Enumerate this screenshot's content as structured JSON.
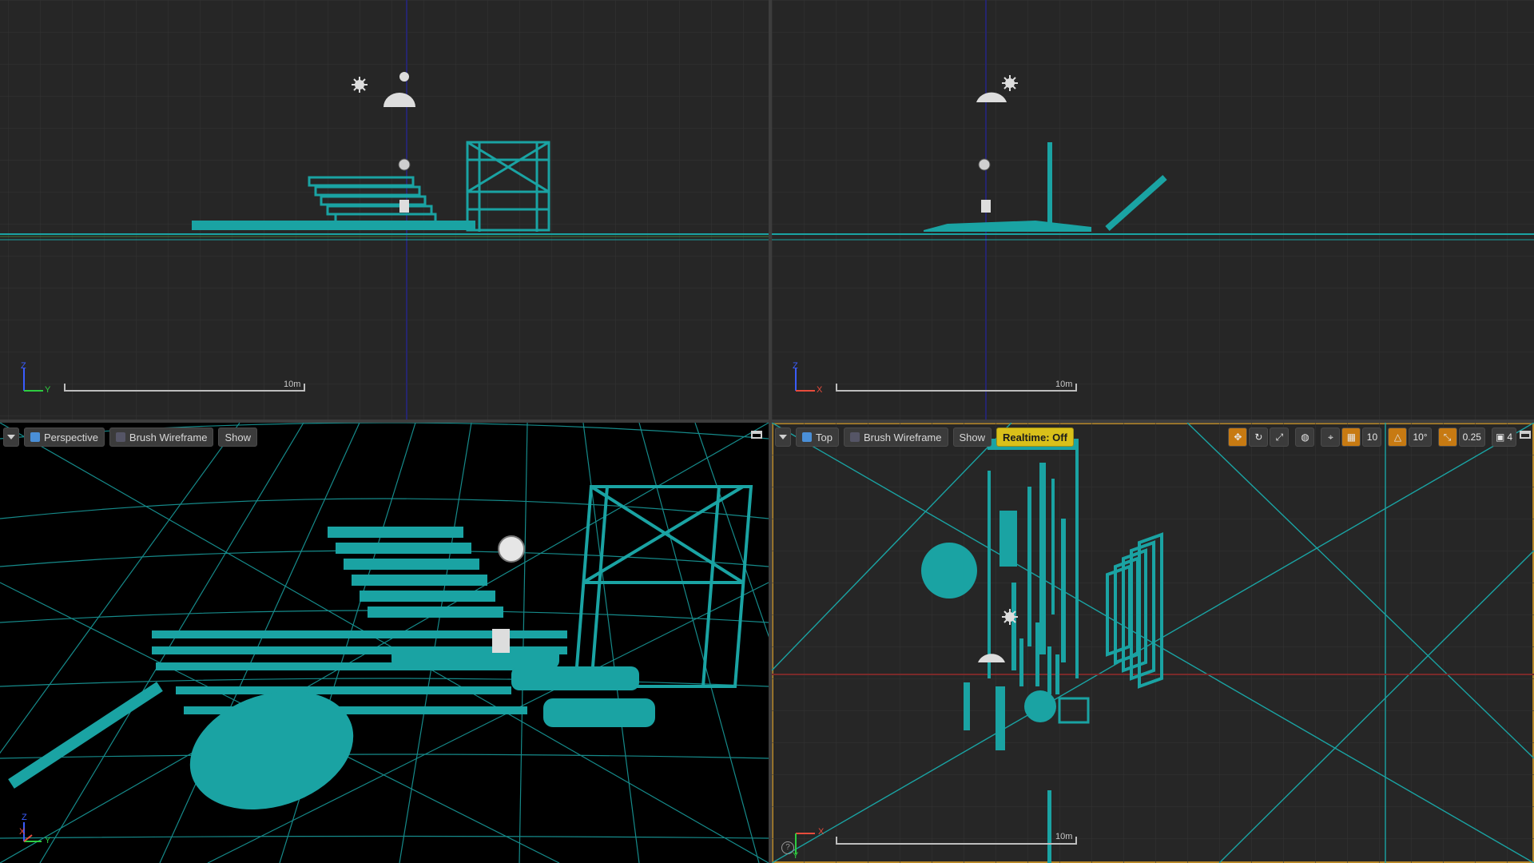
{
  "viewports": {
    "front": {
      "scale_label": "10m",
      "axis_up": "Z",
      "axis_right": "Y"
    },
    "side": {
      "scale_label": "10m",
      "axis_up": "Z",
      "axis_right": "X"
    },
    "perspective": {
      "view_label": "Perspective",
      "mode_label": "Brush Wireframe",
      "show_label": "Show",
      "axis_up": "Z",
      "axis_right": "Y",
      "axis_mid": "X"
    },
    "top": {
      "view_label": "Top",
      "mode_label": "Brush Wireframe",
      "show_label": "Show",
      "realtime_label": "Realtime: Off",
      "grid_snap": "10",
      "rotation_snap": "10°",
      "scale_snap": "0.25",
      "camera_speed": "4",
      "scale_label": "10m",
      "axis_right": "X",
      "axis_down": "Y",
      "help": "?"
    }
  },
  "colors": {
    "wire": "#1aa3a3",
    "grid": "#333333",
    "toolbar_bg": "#3b3b3b",
    "realtime_bg": "#d9c01a",
    "active_border": "#b8892a",
    "snap_orange": "#c77a12"
  }
}
